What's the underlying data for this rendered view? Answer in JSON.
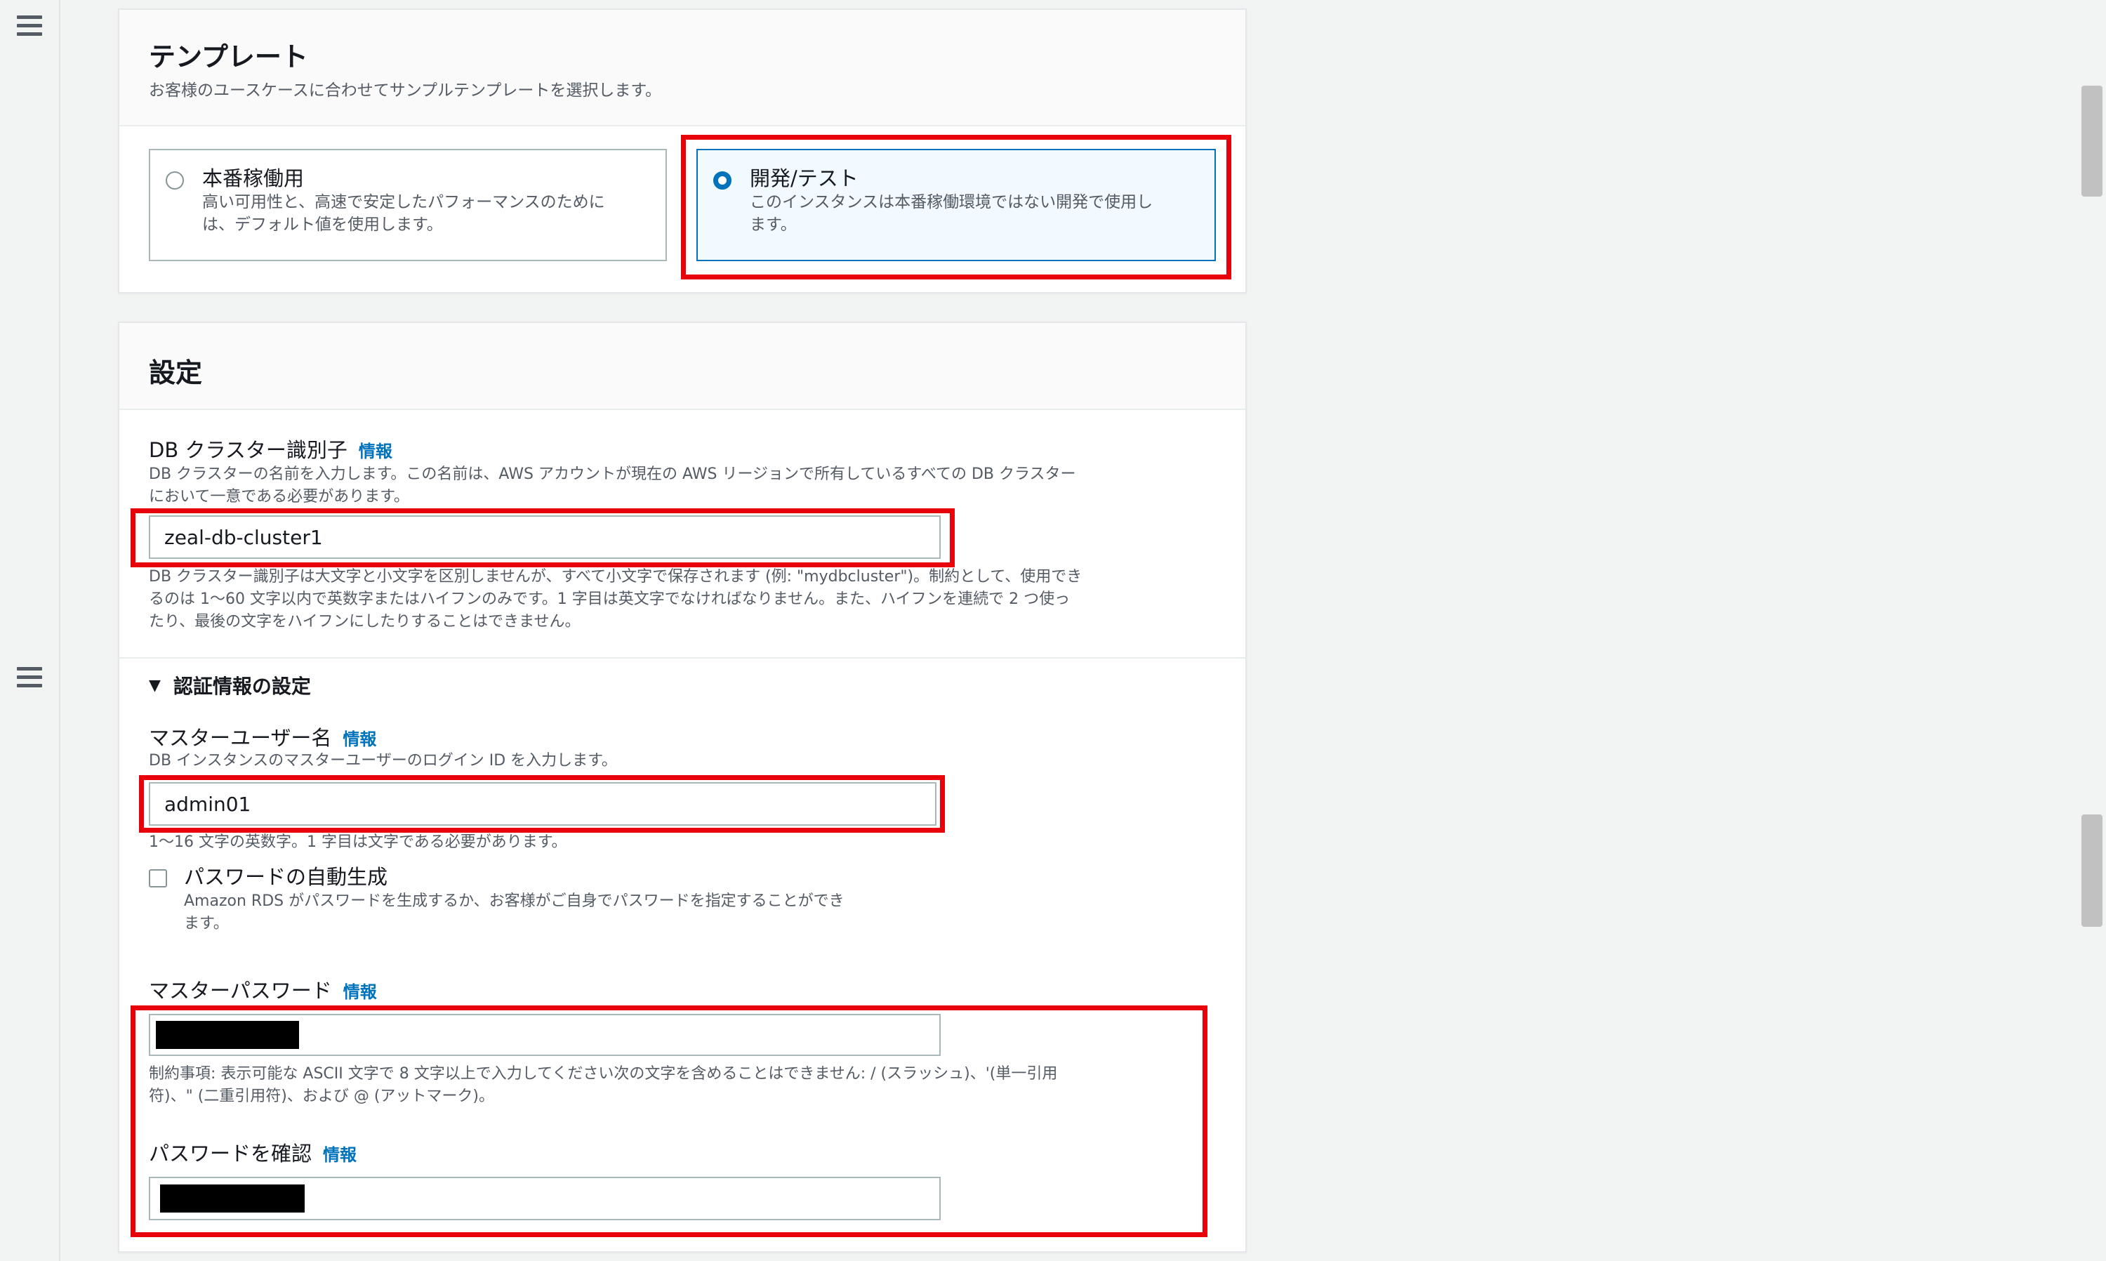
{
  "template_section": {
    "title": "テンプレート",
    "description": "お客様のユースケースに合わせてサンプルテンプレートを選択します。",
    "options": [
      {
        "title": "本番稼働用",
        "description_line1": "高い可用性と、高速で安定したパフォーマンスのために",
        "description_line2": "は、デフォルト値を使用します。",
        "selected": false
      },
      {
        "title": "開発/テスト",
        "description_line1": "このインスタンスは本番稼働環境ではない開発で使用し",
        "description_line2": "ます。",
        "selected": true
      }
    ]
  },
  "settings_section": {
    "title": "設定",
    "cluster_id": {
      "label": "DB クラスター識別子",
      "info": "情報",
      "description_line1": "DB クラスターの名前を入力します。この名前は、AWS アカウントが現在の AWS リージョンで所有しているすべての DB クラスター",
      "description_line2": "において一意である必要があります。",
      "value": "zeal-db-cluster1",
      "constraint_line1": "DB クラスター識別子は大文字と小文字を区別しませんが、すべて小文字で保存されます (例: \"mydbcluster\")。制約として、使用でき",
      "constraint_line2": "るのは 1～60 文字以内で英数字またはハイフンのみです。1 字目は英文字でなければなりません。また、ハイフンを連続で 2 つ使っ",
      "constraint_line3": "たり、最後の文字をハイフンにしたりすることはできません。"
    },
    "credentials": {
      "toggle_label": "認証情報の設定",
      "username": {
        "label": "マスターユーザー名",
        "info": "情報",
        "description": "DB インスタンスのマスターユーザーのログイン ID を入力します。",
        "value": "admin01",
        "constraint": "1～16 文字の英数字。1 字目は文字である必要があります。"
      },
      "auto_password": {
        "label": "パスワードの自動生成",
        "description_line1": "Amazon RDS がパスワードを生成するか、お客様がご自身でパスワードを指定することができ",
        "description_line2": "ます。",
        "checked": false
      },
      "password": {
        "label": "マスターパスワード",
        "info": "情報",
        "constraint_line1": "制約事項: 表示可能な ASCII 文字で 8 文字以上で入力してください次の文字を含めることはできません: / (スラッシュ)、'(単一引用",
        "constraint_line2": "符)、\" (二重引用符)、および @ (アットマーク)。"
      },
      "confirm_password": {
        "label": "パスワードを確認",
        "info": "情報"
      }
    }
  },
  "colors": {
    "highlight": "#e8000b",
    "link": "#0073bb",
    "selected_tile_bg": "#f1faff"
  }
}
